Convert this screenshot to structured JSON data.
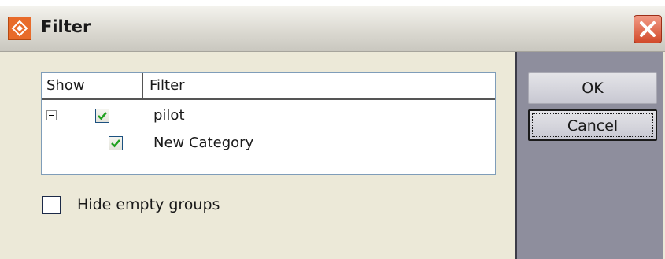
{
  "window": {
    "title": "Filter",
    "app_icon": "app-logo-icon",
    "close_icon": "close-icon"
  },
  "tree": {
    "columns": [
      "Show",
      "Filter"
    ],
    "rows": [
      {
        "label": "pilot",
        "checked": true,
        "expanded": true,
        "indent": 0
      },
      {
        "label": "New Category",
        "checked": true,
        "indent": 1
      }
    ]
  },
  "options": {
    "hide_empty_label": "Hide empty groups",
    "hide_empty_checked": false
  },
  "buttons": {
    "ok_label": "OK",
    "cancel_label": "Cancel"
  },
  "colors": {
    "check_mark": "#21a121",
    "close_button": "#d24a2b",
    "app_icon": "#e86b2a"
  }
}
